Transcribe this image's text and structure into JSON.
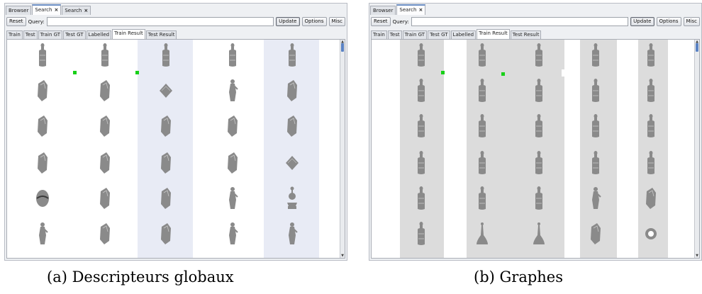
{
  "panel_a": {
    "window_tabs": [
      {
        "label": "Browser",
        "active": false,
        "closable": false
      },
      {
        "label": "Search",
        "active": true,
        "closable": true
      },
      {
        "label": "Search",
        "active": false,
        "closable": true
      }
    ],
    "reset_label": "Reset",
    "query_label": "Query:",
    "query_value": "",
    "update_label": "Update",
    "options_label": "Options",
    "misc_label": "Misc",
    "view_tabs": [
      "Train",
      "Test",
      "Train GT",
      "Test GT",
      "Labelled",
      "Train Result",
      "Test Result"
    ],
    "active_view_tab": "Train Result",
    "caption": "(a) Descripteurs globaux"
  },
  "panel_b": {
    "window_tabs": [
      {
        "label": "Browser",
        "active": false,
        "closable": false
      },
      {
        "label": "Search",
        "active": true,
        "closable": true
      }
    ],
    "reset_label": "Reset",
    "query_label": "Query:",
    "query_value": "",
    "update_label": "Update",
    "options_label": "Options",
    "misc_label": "Misc",
    "view_tabs": [
      "Train",
      "Test",
      "Train GT",
      "Test GT",
      "Labelled",
      "Train Result",
      "Test Result"
    ],
    "active_view_tab": "Train Result",
    "caption": "(b) Graphes"
  },
  "colors": {
    "tab_accent": "#6b8ec4",
    "match_marker": "#18d018",
    "column_shade_a": "#e8ebf5",
    "column_shade_b": "#dcdcdc",
    "object_fill": "#8a8a8a"
  },
  "result_icons_a": [
    [
      "bottle-artifact-icon",
      "bottle-artifact-icon",
      "bottle-artifact-icon",
      "bottle-artifact-icon",
      "bottle-artifact-icon"
    ],
    [
      "fragment-icon",
      "fragment-icon",
      "flat-tile-icon",
      "figurine-icon",
      "fragment-icon"
    ],
    [
      "fragment-icon",
      "fragment-icon",
      "fragment-icon",
      "fragment-icon",
      "fragment-icon"
    ],
    [
      "fragment-icon",
      "fragment-icon",
      "fragment-icon",
      "fragment-icon",
      "flat-tile-icon"
    ],
    [
      "sphere-icon",
      "fragment-icon",
      "fragment-icon",
      "figurine-icon",
      "vase-icon"
    ],
    [
      "figurine-icon",
      "fragment-icon",
      "fragment-icon",
      "figurine-icon",
      "figurine-icon"
    ]
  ],
  "result_icons_b": [
    [
      "bottle-artifact-icon",
      "bottle-artifact-icon",
      "bottle-artifact-icon",
      "bottle-artifact-icon",
      "bottle-artifact-icon"
    ],
    [
      "bottle-artifact-icon",
      "bottle-artifact-icon",
      "bottle-artifact-icon",
      "bottle-artifact-icon",
      "bottle-artifact-icon"
    ],
    [
      "bottle-artifact-icon",
      "bottle-artifact-icon",
      "bottle-artifact-icon",
      "bottle-artifact-icon",
      "bottle-artifact-icon"
    ],
    [
      "bottle-artifact-icon",
      "bottle-artifact-icon",
      "bottle-artifact-icon",
      "bottle-artifact-icon",
      "bottle-artifact-icon"
    ],
    [
      "bottle-artifact-icon",
      "bottle-artifact-icon",
      "bottle-artifact-icon",
      "figurine-icon",
      "fragment-icon"
    ],
    [
      "bottle-artifact-icon",
      "bell-icon",
      "bell-icon",
      "fragment-icon",
      "ring-icon"
    ]
  ]
}
